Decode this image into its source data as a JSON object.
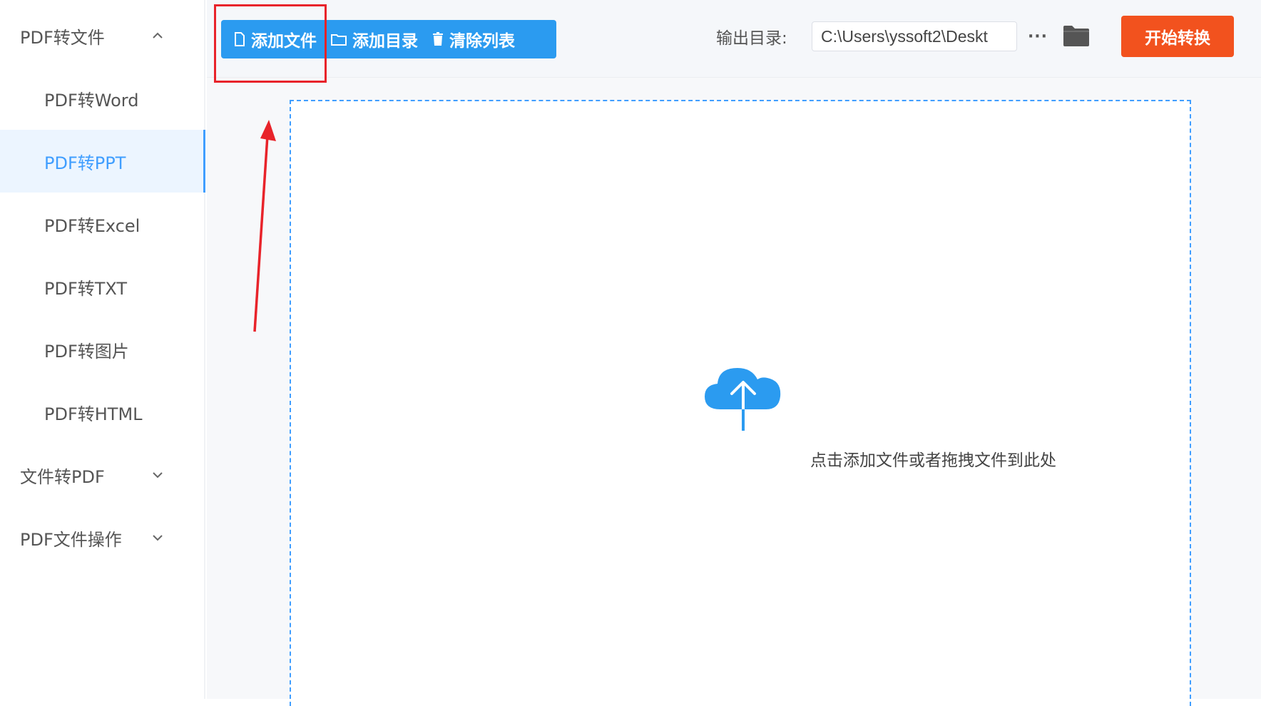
{
  "sidebar": {
    "groups": [
      {
        "label": "PDF转文件",
        "expanded": true,
        "items": [
          {
            "label": "PDF转Word"
          },
          {
            "label": "PDF转PPT",
            "active": true
          },
          {
            "label": "PDF转Excel"
          },
          {
            "label": "PDF转TXT"
          },
          {
            "label": "PDF转图片"
          },
          {
            "label": "PDF转HTML"
          }
        ]
      },
      {
        "label": "文件转PDF",
        "expanded": false
      },
      {
        "label": "PDF文件操作",
        "expanded": false
      }
    ]
  },
  "toolbar": {
    "add_file_label": "添加文件",
    "add_dir_label": "添加目录",
    "clear_list_label": "清除列表",
    "output_label": "输出目录:",
    "output_path": "C:\\Users\\yssoft2\\Deskt",
    "more_label": "···",
    "start_label": "开始转换"
  },
  "dropzone": {
    "hint": "点击添加文件或者拖拽文件到此处",
    "icon": "cloud-upload-icon"
  },
  "colors": {
    "accent": "#409eff",
    "toolbar_button": "#2b9bf0",
    "start_button": "#f2521e",
    "annotation": "#e8232a"
  }
}
